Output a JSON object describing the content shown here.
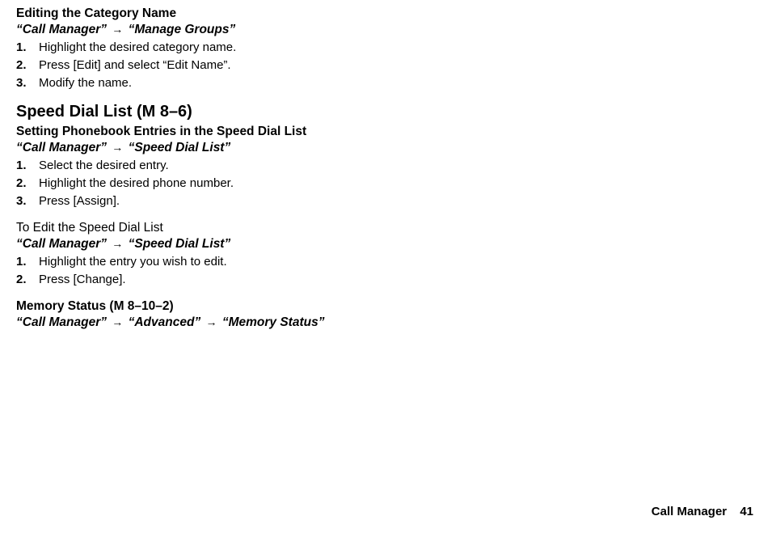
{
  "block1": {
    "subtitle": "Editing the Category Name",
    "path_a": "“Call Manager”",
    "path_b": "“Manage Groups”",
    "steps": [
      {
        "num": "1.",
        "text": "Highlight the desired category name."
      },
      {
        "num": "2.",
        "text": "Press [Edit] and select “Edit Name”."
      },
      {
        "num": "3.",
        "text": "Modify the name."
      }
    ]
  },
  "heading2": {
    "title": "Speed Dial List ",
    "code": "(M 8–6)"
  },
  "block2": {
    "subtitle": "Setting Phonebook Entries in the Speed Dial List",
    "path_a": "“Call Manager”",
    "path_b": "“Speed Dial List”",
    "steps": [
      {
        "num": "1.",
        "text": "Select the desired entry."
      },
      {
        "num": "2.",
        "text": "Highlight the desired phone number."
      },
      {
        "num": "3.",
        "text": "Press [Assign]."
      }
    ]
  },
  "block3": {
    "subtitle": "To Edit the Speed Dial List",
    "path_a": "“Call Manager”",
    "path_b": "“Speed Dial List”",
    "steps": [
      {
        "num": "1.",
        "text": "Highlight the entry you wish to edit."
      },
      {
        "num": "2.",
        "text": "Press [Change]."
      }
    ]
  },
  "block4": {
    "subtitle": "Memory Status (M 8–10–2)",
    "path_a": "“Call Manager”",
    "path_b": "“Advanced”",
    "path_c": "“Memory Status”"
  },
  "arrow": "→",
  "footer": {
    "label": "Call Manager",
    "page": "41"
  }
}
